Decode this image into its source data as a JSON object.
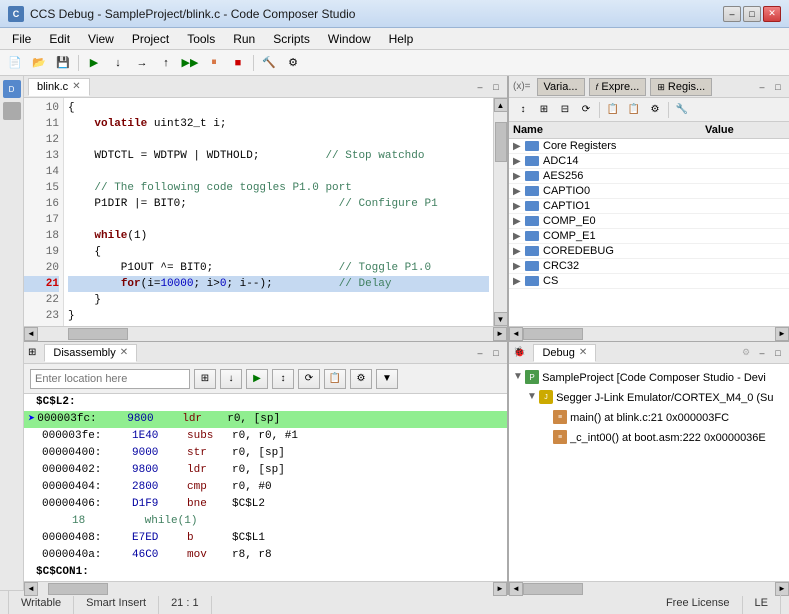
{
  "titleBar": {
    "title": "CCS Debug - SampleProject/blink.c - Code Composer Studio",
    "icon": "CCS",
    "minimize": "–",
    "maximize": "□",
    "close": "✕"
  },
  "menuBar": {
    "items": [
      "File",
      "Edit",
      "View",
      "Project",
      "Tools",
      "Run",
      "Scripts",
      "Window",
      "Help"
    ]
  },
  "editorPanel": {
    "tabLabel": "blink.c",
    "lines": [
      {
        "num": "10",
        "code": "{",
        "class": ""
      },
      {
        "num": "11",
        "code": "    volatile uint32_t i;",
        "class": ""
      },
      {
        "num": "12",
        "code": "",
        "class": ""
      },
      {
        "num": "13",
        "code": "    WDTCTL = WDTPW | WDTHOLD;          // Stop watchdo",
        "class": ""
      },
      {
        "num": "14",
        "code": "",
        "class": ""
      },
      {
        "num": "15",
        "code": "    // The following code toggles P1.0 port",
        "class": "comment"
      },
      {
        "num": "16",
        "code": "    P1DIR |= BIT0;                       // Configure P1",
        "class": ""
      },
      {
        "num": "17",
        "code": "",
        "class": ""
      },
      {
        "num": "18",
        "code": "    while(1)",
        "class": ""
      },
      {
        "num": "19",
        "code": "    {",
        "class": ""
      },
      {
        "num": "20",
        "code": "        P1OUT ^= BIT0;                   // Toggle P1.0",
        "class": ""
      },
      {
        "num": "21",
        "code": "        for(i=10000; i>0; i--);          // Delay",
        "class": "highlighted"
      },
      {
        "num": "22",
        "code": "    }",
        "class": ""
      },
      {
        "num": "23",
        "code": "}",
        "class": ""
      }
    ]
  },
  "registersPanel": {
    "tabs": [
      "Varia...",
      "Expre...",
      "Regis..."
    ],
    "activeTab": "Regis...",
    "header": {
      "name": "Name",
      "value": "Value"
    },
    "items": [
      {
        "name": "Core Registers",
        "hasChildren": true,
        "expanded": false
      },
      {
        "name": "ADC14",
        "hasChildren": true,
        "expanded": false
      },
      {
        "name": "AES256",
        "hasChildren": true,
        "expanded": false
      },
      {
        "name": "CAPTIO0",
        "hasChildren": true,
        "expanded": false
      },
      {
        "name": "CAPTIO1",
        "hasChildren": true,
        "expanded": false
      },
      {
        "name": "COMP_E0",
        "hasChildren": true,
        "expanded": false
      },
      {
        "name": "COMP_E1",
        "hasChildren": true,
        "expanded": false
      },
      {
        "name": "COREDEBUG",
        "hasChildren": true,
        "expanded": false
      },
      {
        "name": "CRC32",
        "hasChildren": true,
        "expanded": false
      },
      {
        "name": "CS",
        "hasChildren": true,
        "expanded": false
      }
    ]
  },
  "disassemblyPanel": {
    "tabLabel": "Disassembly",
    "locationPlaceholder": "Enter location here",
    "label1": "$C$L2:",
    "rows": [
      {
        "addr": "000003fc:",
        "hex": "9800",
        "mnem": "ldr",
        "ops": "r0, [sp]",
        "current": true,
        "indent": false
      },
      {
        "addr": "000003fe:",
        "hex": "1E40",
        "mnem": "subs",
        "ops": "r0, r0, #1",
        "current": false,
        "indent": false
      },
      {
        "addr": "00000400:",
        "hex": "9000",
        "mnem": "str",
        "ops": "r0, [sp]",
        "current": false,
        "indent": false
      },
      {
        "addr": "00000402:",
        "hex": "9800",
        "mnem": "ldr",
        "ops": "r0, [sp]",
        "current": false,
        "indent": false
      },
      {
        "addr": "00000404:",
        "hex": "2800",
        "mnem": "cmp",
        "ops": "r0, #0",
        "current": false,
        "indent": false
      },
      {
        "addr": "00000406:",
        "hex": "D1F9",
        "mnem": "bne",
        "ops": "$C$L2",
        "current": false,
        "indent": false
      },
      {
        "addr": "18",
        "hex": "",
        "mnem": "",
        "ops": "while(1)",
        "current": false,
        "indent": true,
        "comment": true
      },
      {
        "addr": "00000408:",
        "hex": "E7ED",
        "mnem": "b",
        "ops": "$C$L1",
        "current": false,
        "indent": false
      },
      {
        "addr": "0000040a:",
        "hex": "46C0",
        "mnem": "mov",
        "ops": "r8, r8",
        "current": false,
        "indent": false
      },
      {
        "addr": "$C$CON1:",
        "hex": "",
        "mnem": "",
        "ops": "",
        "current": false,
        "indent": false,
        "label": true
      }
    ]
  },
  "debugPanel": {
    "tabLabel": "Debug",
    "tree": {
      "projectName": "SampleProject [Code Composer Studio - Devi",
      "emulator": "Segger J-Link Emulator/CORTEX_M4_0 (Su",
      "functions": [
        {
          "name": "main() at blink.c:21 0x000003FC"
        },
        {
          "name": "_c_int00() at boot.asm:222 0x0000036E"
        }
      ]
    }
  },
  "statusBar": {
    "writable": "Writable",
    "smartInsert": "Smart Insert",
    "position": "21 : 1",
    "license": "Free License",
    "le": "LE"
  }
}
